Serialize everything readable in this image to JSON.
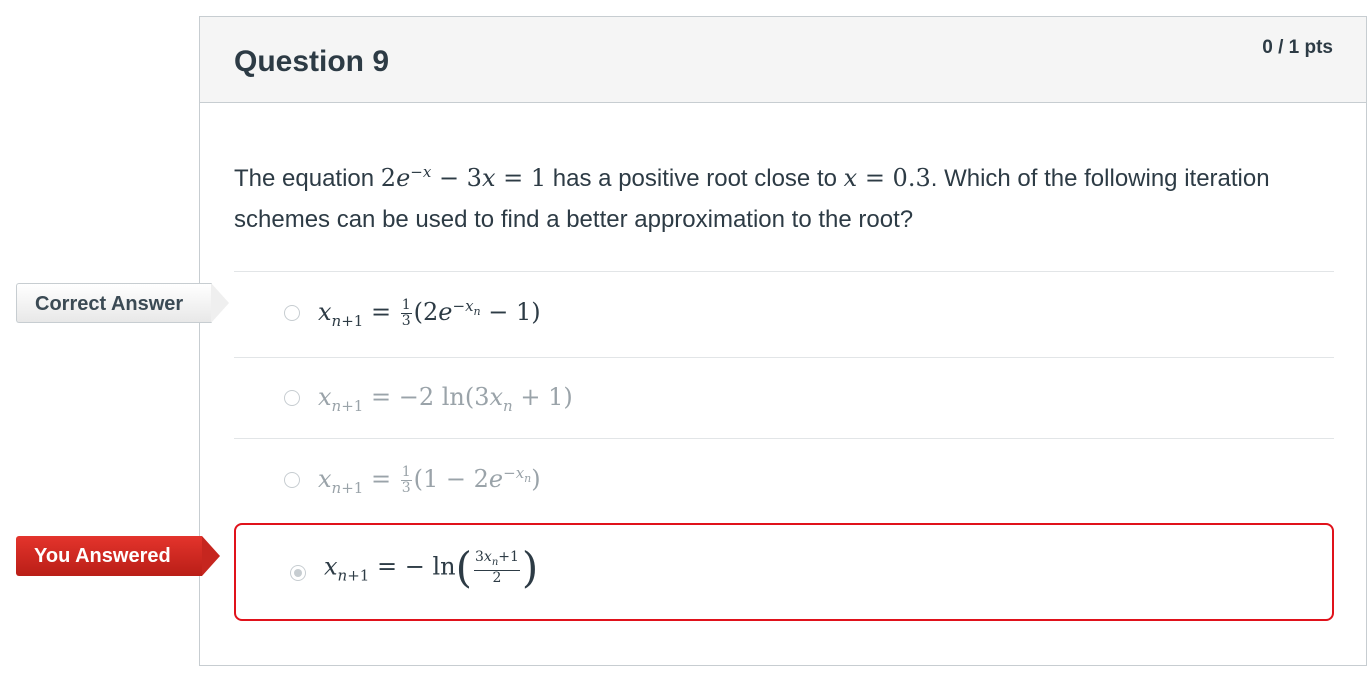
{
  "question": {
    "title": "Question 9",
    "points": "0 / 1 pts",
    "text_parts": {
      "p1": "The equation ",
      "p2": " has a positive root close to ",
      "p3": ". Which of the following iteration schemes can be used to find a better approximation to the root?"
    }
  },
  "tags": {
    "correct": "Correct Answer",
    "you_answered": "You Answered"
  },
  "answers": [
    {
      "state": "correct",
      "selected": false
    },
    {
      "state": "neutral",
      "selected": false
    },
    {
      "state": "neutral",
      "selected": false
    },
    {
      "state": "you_answered_wrong",
      "selected": true
    }
  ],
  "colors": {
    "wrong_border": "#e0121b",
    "wrong_tag": "#c6261f",
    "text": "#2d3b45",
    "dim_text": "#9aa3a9"
  }
}
